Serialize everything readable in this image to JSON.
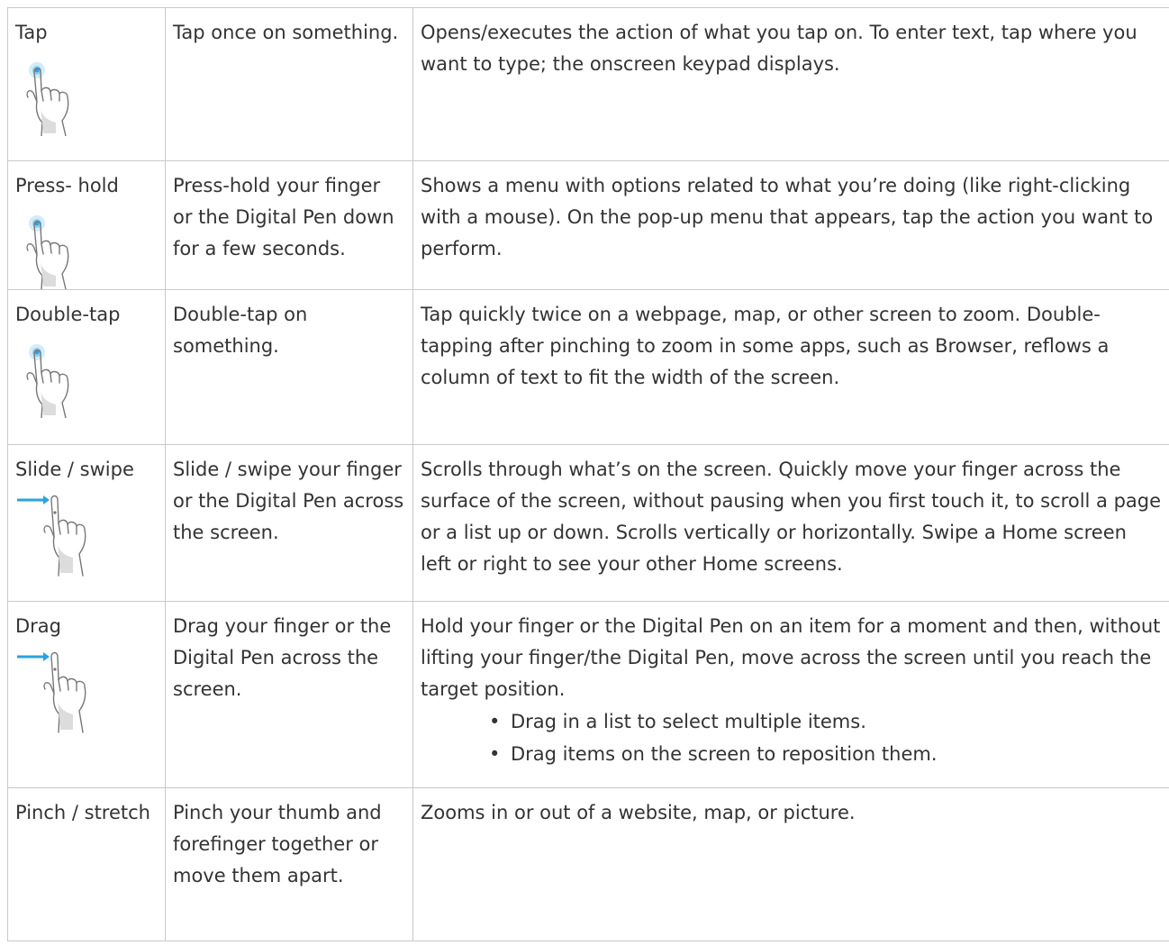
{
  "rows": [
    {
      "gesture": "Tap",
      "icon": "tap-hand-icon",
      "how": "Tap once on something.",
      "result": "Opens/executes the action of what you tap on. To enter text, tap where you want to type; the onscreen keypad displays."
    },
    {
      "gesture": "Press- hold",
      "icon": "press-hold-hand-icon",
      "how": "Press-hold your finger or the Digital Pen down for a few seconds.",
      "result": "Shows a menu with options related to what you’re doing (like right-clicking with a mouse). On the pop-up menu that appears, tap the action you want to perform."
    },
    {
      "gesture": "Double-tap",
      "icon": "double-tap-hand-icon",
      "how": "Double-tap on something.",
      "result": "Tap quickly twice on a webpage, map, or other screen to zoom. Double-tapping after pinching to zoom in some apps, such as Browser, reflows a column of text to fit the width of the screen."
    },
    {
      "gesture": "Slide / swipe",
      "icon": "swipe-hand-icon",
      "how": "Slide / swipe your finger or the Digital Pen across the screen.",
      "result": "Scrolls through what’s on the screen. Quickly move your finger across the surface of the screen, without pausing when you first touch it, to scroll a page or a list up or down. Scrolls vertically or horizontally. Swipe a Home screen left or right to see your other Home screens."
    },
    {
      "gesture": "Drag",
      "icon": "drag-hand-icon",
      "how": "Drag your finger or the Digital Pen across the screen.",
      "result": "Hold your finger or the Digital Pen on an item for a moment and then, without lifting your finger/the Digital Pen, move across the screen until you reach the target position.",
      "bullets": [
        "Drag in a list to select multiple items.",
        "Drag items on the screen to reposition them."
      ]
    },
    {
      "gesture": "Pinch / stretch",
      "how": "Pinch your thumb and forefinger together or move them apart.",
      "result": "Zooms in or out of a website, map, or picture."
    }
  ],
  "bullet_glyph": "•",
  "colors": {
    "border": "#c9c9c9",
    "text": "#333333",
    "accent": "#29a3e0"
  }
}
